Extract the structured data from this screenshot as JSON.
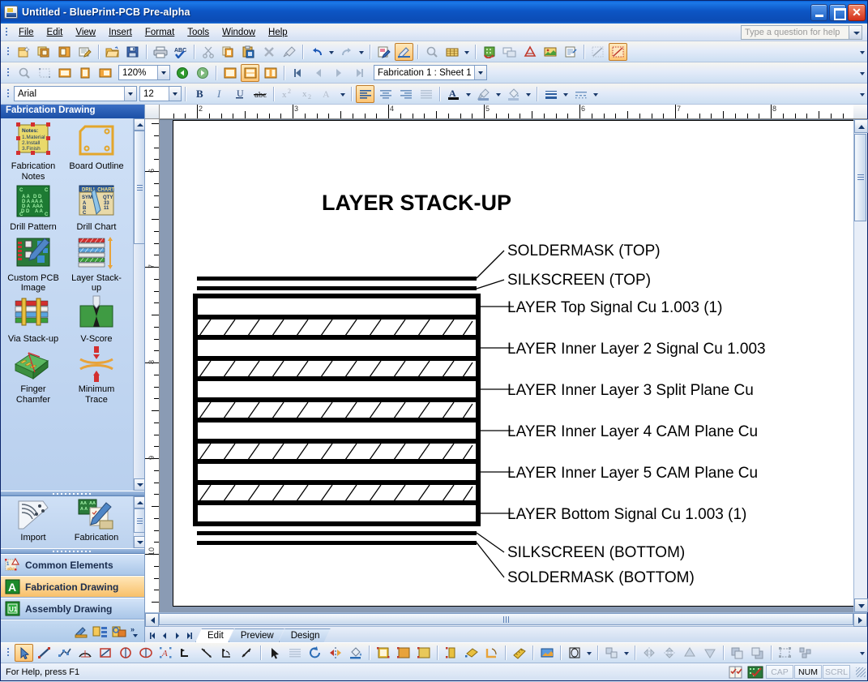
{
  "window": {
    "title": "Untitled - BluePrint-PCB Pre-alpha",
    "icon": "app-icon",
    "minimize": "_",
    "maximize": "□",
    "close": "✕"
  },
  "menubar": {
    "items": [
      "File",
      "Edit",
      "View",
      "Insert",
      "Format",
      "Tools",
      "Window",
      "Help"
    ],
    "help_search_placeholder": "Type a question for help"
  },
  "toolbars": {
    "standard": [
      "new-document-icon",
      "new-sheet-icon",
      "new-view-icon",
      "new-note-icon",
      "open-icon",
      "save-icon",
      "print-icon",
      "spelling-icon",
      "cut-icon",
      "copy-icon",
      "paste-icon",
      "delete-icon",
      "format-painter-icon",
      "undo-icon",
      "undo-dropdown-icon",
      "redo-icon",
      "redo-dropdown-icon",
      "edit-sheet-icon",
      "edit-view-icon",
      "zoom-icon",
      "grid-icon",
      "grid-dropdown-icon",
      "refresh-icon",
      "callout-icon",
      "dimension-icon",
      "image-icon",
      "table-icon",
      "snap-icon",
      "snap-grid-icon"
    ],
    "view": [
      "zoom-tool-icon",
      "zoom-window-icon",
      "zoom-fit-icon",
      "zoom-page-icon",
      "zoom-selection-icon"
    ],
    "zoom_value": "120%",
    "nav": [
      "back-icon",
      "forward-icon"
    ],
    "layout": [
      "single-view-icon",
      "horizontal-split-icon",
      "vertical-split-icon"
    ],
    "paging": [
      "first-sheet-icon",
      "prev-sheet-icon",
      "next-sheet-icon",
      "last-sheet-icon"
    ],
    "sheet_selector": "Fabrication 1 : Sheet 1",
    "font_name": "Arial",
    "font_size": "12",
    "format": [
      "bold-icon",
      "italic-icon",
      "underline-icon",
      "strikethrough-icon",
      "superscript-icon",
      "subscript-icon",
      "text-scale-icon",
      "align-left-icon",
      "align-center-icon",
      "align-right-icon",
      "align-justify-icon",
      "font-color-icon",
      "font-color-dropdown-icon",
      "line-color-icon",
      "line-color-dropdown-icon",
      "fill-color-icon",
      "fill-color-dropdown-icon",
      "line-weight-icon",
      "line-weight-dropdown-icon",
      "line-style-icon",
      "line-style-dropdown-icon"
    ],
    "draw": [
      "select-pointer-icon",
      "line-icon",
      "polyline-icon",
      "arc-icon",
      "rectangle-icon",
      "circle-icon",
      "ellipse-icon",
      "text-icon",
      "leader-icon",
      "dimension-linear-icon",
      "dimension-angular-icon",
      "dimension-radial-icon",
      "pick-icon",
      "hatch-icon",
      "rotate-icon",
      "mirror-icon",
      "fill-tool-icon",
      "drill-table-icon",
      "board-outline-icon",
      "layer-stackup-icon",
      "via-stackup-icon",
      "v-score-icon",
      "chamfer-icon",
      "measure-icon",
      "picture-frame-icon",
      "shape-icon",
      "shape-dropdown-icon",
      "align-objects-icon",
      "align-objects-dropdown-icon",
      "flip-horizontal-icon",
      "flip-vertical-icon",
      "align-top-icon",
      "align-bottom-icon",
      "bring-front-icon",
      "send-back-icon",
      "group-icon",
      "ungroup-icon"
    ]
  },
  "panel": {
    "title": "Fabrication Drawing",
    "gallery": [
      {
        "label": "Fabrication Notes",
        "icon": "fabrication-notes-icon"
      },
      {
        "label": "Board Outline",
        "icon": "board-outline-icon"
      },
      {
        "label": "Drill Pattern",
        "icon": "drill-pattern-icon"
      },
      {
        "label": "Drill Chart",
        "icon": "drill-chart-icon"
      },
      {
        "label": "Custom PCB Image",
        "icon": "custom-pcb-image-icon"
      },
      {
        "label": "Layer Stack-up",
        "icon": "layer-stackup-icon"
      },
      {
        "label": "Via Stack-up",
        "icon": "via-stackup-icon"
      },
      {
        "label": "V-Score",
        "icon": "v-score-icon"
      },
      {
        "label": "Finger Chamfer",
        "icon": "finger-chamfer-icon"
      },
      {
        "label": "Minimum Trace",
        "icon": "minimum-trace-icon"
      }
    ],
    "gallery2": [
      {
        "label": "Import",
        "icon": "import-icon"
      },
      {
        "label": "Fabrication",
        "icon": "fabrication-icon"
      }
    ],
    "sections": [
      {
        "label": "Common Elements",
        "icon": "common-elements-icon",
        "active": false
      },
      {
        "label": "Fabrication Drawing",
        "icon": "fabrication-drawing-icon",
        "active": true
      },
      {
        "label": "Assembly Drawing",
        "icon": "assembly-drawing-icon",
        "active": false
      }
    ],
    "footer_buttons": [
      "export-icon",
      "tree-view-icon",
      "properties-icon",
      "more-icon"
    ]
  },
  "rulers": {
    "horizontal_ticks": [
      "2",
      "3",
      "4",
      "5",
      "6",
      "7",
      "8"
    ],
    "vertical_ticks": [
      "6",
      "7",
      "8",
      "9",
      "10"
    ]
  },
  "chart_data": {
    "type": "diagram",
    "title": "LAYER STACK-UP",
    "description": "PCB layer stack-up cross-section with leader-line callouts",
    "outer_layers": [
      {
        "name": "SOLDERMASK (TOP)",
        "kind": "thin-line",
        "position": "top"
      },
      {
        "name": "SILKSCREEN (TOP)",
        "kind": "thin-line",
        "position": "top"
      },
      {
        "name": "SILKSCREEN (BOTTOM)",
        "kind": "thin-line",
        "position": "bottom"
      },
      {
        "name": "SOLDERMASK (BOTTOM)",
        "kind": "thin-line",
        "position": "bottom"
      }
    ],
    "stack": [
      {
        "label": "LAYER Top Signal Cu 1.003 (1)",
        "fill": "solid",
        "type": "copper"
      },
      {
        "label": "",
        "fill": "hatch",
        "type": "dielectric"
      },
      {
        "label": "LAYER Inner Layer 2 Signal Cu 1.003",
        "fill": "solid",
        "type": "copper"
      },
      {
        "label": "",
        "fill": "hatch",
        "type": "dielectric"
      },
      {
        "label": "LAYER Inner Layer 3 Split Plane Cu",
        "fill": "solid",
        "type": "copper"
      },
      {
        "label": "",
        "fill": "hatch",
        "type": "dielectric"
      },
      {
        "label": "LAYER Inner Layer 4 CAM Plane Cu",
        "fill": "solid",
        "type": "copper"
      },
      {
        "label": "",
        "fill": "hatch",
        "type": "dielectric"
      },
      {
        "label": "LAYER Inner Layer 5 CAM Plane Cu",
        "fill": "solid",
        "type": "copper"
      },
      {
        "label": "",
        "fill": "hatch",
        "type": "dielectric"
      },
      {
        "label": "LAYER Bottom Signal Cu 1.003 (1)",
        "fill": "solid",
        "type": "copper"
      }
    ],
    "callouts": [
      "SOLDERMASK (TOP)",
      "SILKSCREEN (TOP)",
      "LAYER Top Signal Cu 1.003 (1)",
      "LAYER Inner Layer 2 Signal Cu 1.003",
      "LAYER Inner Layer 3 Split Plane Cu",
      "LAYER Inner Layer 4 CAM Plane Cu",
      "LAYER Inner Layer 5 CAM Plane Cu",
      "LAYER Bottom Signal Cu 1.003 (1)",
      "SILKSCREEN (BOTTOM)",
      "SOLDERMASK (BOTTOM)"
    ]
  },
  "sheet_tabs": {
    "nav": [
      "first-icon",
      "prev-icon",
      "next-icon",
      "last-icon"
    ],
    "tabs": [
      {
        "label": "Edit",
        "active": true
      },
      {
        "label": "Preview",
        "active": false
      },
      {
        "label": "Design",
        "active": false
      }
    ]
  },
  "statusbar": {
    "message": "For Help, press F1",
    "indicators": [
      {
        "label": "CAP",
        "on": false
      },
      {
        "label": "NUM",
        "on": true
      },
      {
        "label": "SCRL",
        "on": false
      }
    ],
    "icons": [
      "notes-check-icon",
      "board-check-icon"
    ]
  },
  "colors": {
    "title_blue": "#0b4cb5",
    "panel_blue": "#c3d8f0",
    "accent_orange": "#f8c069",
    "canvas_gray": "#8a9bb4"
  }
}
